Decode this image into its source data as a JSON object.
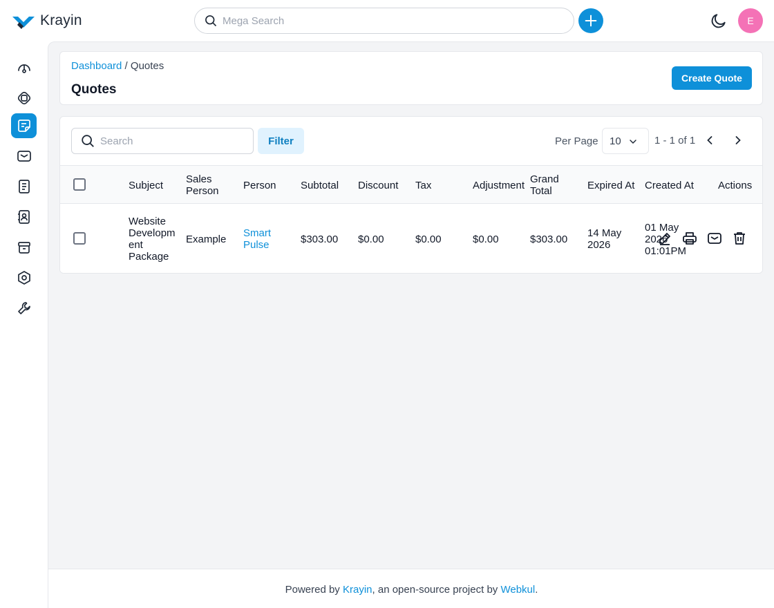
{
  "app": {
    "name": "Krayin"
  },
  "header": {
    "search_placeholder": "Mega Search",
    "avatar_initial": "E"
  },
  "breadcrumb": {
    "parent": "Dashboard",
    "separator": " / ",
    "current": "Quotes"
  },
  "page": {
    "title": "Quotes",
    "create_label": "Create Quote"
  },
  "toolbar": {
    "search_placeholder": "Search",
    "filter_label": "Filter",
    "per_page_label": "Per Page",
    "per_page_value": "10",
    "page_info": "1 - 1 of 1"
  },
  "table": {
    "columns": {
      "subject": "Subject",
      "sales_person_1": "Sales",
      "sales_person_2": "Person",
      "person": "Person",
      "subtotal": "Subtotal",
      "discount": "Discount",
      "tax": "Tax",
      "adjustment": "Adjustment",
      "grand_total_1": "Grand",
      "grand_total_2": "Total",
      "expired_at": "Expired At",
      "created_at": "Created At",
      "actions": "Actions"
    },
    "rows": [
      {
        "subject": [
          "Website",
          "Developm",
          "ent",
          "Package"
        ],
        "sales_person": "Example",
        "person": [
          "Smart",
          "Pulse"
        ],
        "subtotal": "$303.00",
        "discount": "$0.00",
        "tax": "$0.00",
        "adjustment": "$0.00",
        "grand_total": "$303.00",
        "expired_at": [
          "14 May",
          "2026"
        ],
        "created_at": [
          "01 May",
          "2026",
          "01:01PM"
        ]
      }
    ]
  },
  "footer": {
    "prefix": "Powered by ",
    "brand": "Krayin",
    "middle": ", an open-source project by ",
    "company": "Webkul",
    "suffix": "."
  },
  "icons": {
    "sidebar": [
      "dashboard-icon",
      "leads-icon",
      "quotes-icon",
      "mail-icon",
      "activities-icon",
      "contacts-icon",
      "products-icon",
      "settings-icon",
      "configuration-icon"
    ],
    "actions": [
      "edit-icon",
      "print-icon",
      "mail-icon",
      "delete-icon"
    ]
  },
  "colors": {
    "accent": "#0e90d9",
    "avatar": "#f472b6",
    "filter_bg": "#e0f2fe"
  }
}
